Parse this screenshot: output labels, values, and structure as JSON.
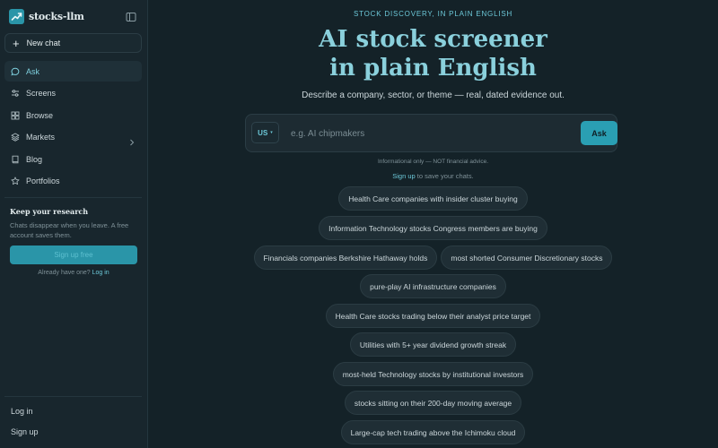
{
  "sidebar": {
    "brand": {
      "name": "stocks-llm",
      "logo_icon": "trend-up-icon",
      "accent": "#2a95a8"
    },
    "collapse_icon": "sidebar-toggle-icon",
    "new_chat": {
      "icon": "plus-icon",
      "label": "New chat"
    },
    "nav": [
      {
        "id": "ask",
        "icon": "chat-bubble-icon",
        "label": "Ask",
        "active": true
      },
      {
        "id": "screens",
        "icon": "sliders-icon",
        "label": "Screens",
        "active": false
      },
      {
        "id": "browse",
        "icon": "grid-icon",
        "label": "Browse",
        "active": false
      },
      {
        "id": "markets",
        "icon": "layers-icon",
        "label": "Markets",
        "active": false,
        "has_submenu": true
      },
      {
        "id": "blog",
        "icon": "book-icon",
        "label": "Blog",
        "active": false
      },
      {
        "id": "portfolios",
        "icon": "star-icon",
        "label": "Portfolios",
        "active": false
      }
    ],
    "research": {
      "title": "Keep your research",
      "text": "Chats disappear when you leave. A free account saves them.",
      "signup_button": "Sign up free",
      "have_account": "Already have one?",
      "login_link": "Log in"
    },
    "bottom": {
      "login": "Log in",
      "signup": "Sign up"
    }
  },
  "main": {
    "eyebrow": "Stock discovery, in plain English",
    "title_line1": "AI stock screener",
    "title_line2": "in plain English",
    "subtitle": "Describe a company, sector, or theme — real, dated evidence out.",
    "search": {
      "country": "US",
      "placeholder": "e.g. AI chipmakers",
      "value": "",
      "ask_label": "Ask",
      "accent": "#2a9fb3"
    },
    "disclaimer": "Informational only — NOT financial advice.",
    "signup_note": {
      "link": "Sign up",
      "text": " to save your chats."
    },
    "suggestion_rows": [
      [
        "Health Care companies with insider cluster buying"
      ],
      [
        "Information Technology stocks Congress members are buying"
      ],
      [
        "Financials companies Berkshire Hathaway holds",
        "most shorted Consumer Discretionary stocks"
      ],
      [
        "pure-play AI infrastructure companies"
      ],
      [
        "Health Care stocks trading below their analyst price target"
      ],
      [
        "Utilities with 5+ year dividend growth streak"
      ],
      [
        "most-held Technology stocks by institutional investors"
      ],
      [
        "stocks sitting on their 200-day moving average"
      ],
      [
        "Large-cap tech trading above the Ichimoku cloud"
      ]
    ]
  }
}
